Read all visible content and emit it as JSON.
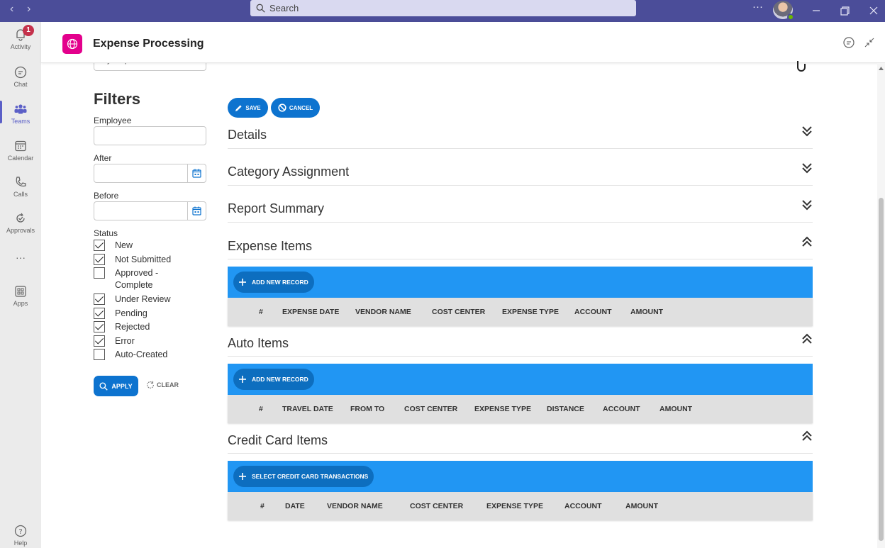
{
  "titlebar": {
    "search_placeholder": "Search",
    "more_label": "···"
  },
  "rail": {
    "items": [
      {
        "label": "Activity",
        "icon": "bell-icon",
        "badge": "1"
      },
      {
        "label": "Chat",
        "icon": "chat-icon"
      },
      {
        "label": "Teams",
        "icon": "teams-icon",
        "active": true
      },
      {
        "label": "Calendar",
        "icon": "calendar-icon"
      },
      {
        "label": "Calls",
        "icon": "phone-icon"
      },
      {
        "label": "Approvals",
        "icon": "approvals-icon"
      },
      {
        "label": "···",
        "icon": "more-icon"
      },
      {
        "label": "Apps",
        "icon": "apps-icon"
      },
      {
        "label": "Help",
        "icon": "help-icon"
      }
    ]
  },
  "app": {
    "title": "Expense Processing",
    "accent": "#e3008c"
  },
  "filters": {
    "view_select_value": "My Reports",
    "title": "Filters",
    "employee_label": "Employee",
    "employee_value": "",
    "after_label": "After",
    "after_value": "",
    "before_label": "Before",
    "before_value": "",
    "status_label": "Status",
    "statuses": [
      {
        "label": "New",
        "checked": true
      },
      {
        "label": "Not Submitted",
        "checked": true
      },
      {
        "label": "Approved -",
        "label2": "Complete",
        "checked": false
      },
      {
        "label": "Under Review",
        "checked": true
      },
      {
        "label": "Pending",
        "checked": true
      },
      {
        "label": "Rejected",
        "checked": true
      },
      {
        "label": "Error",
        "checked": true
      },
      {
        "label": "Auto-Created",
        "checked": false
      }
    ],
    "apply_label": "APPLY",
    "clear_label": "CLEAR"
  },
  "toolbar": {
    "save_label": "SAVE",
    "cancel_label": "CANCEL"
  },
  "sections": {
    "details": "Details",
    "category": "Category Assignment",
    "summary": "Report Summary",
    "expense_items": "Expense Items",
    "auto_items": "Auto Items",
    "credit_card_items": "Credit Card Items"
  },
  "expense_grid": {
    "add_label": "ADD NEW RECORD",
    "columns": [
      "#",
      "EXPENSE DATE",
      "VENDOR NAME",
      "COST CENTER",
      "EXPENSE TYPE",
      "ACCOUNT",
      "AMOUNT"
    ]
  },
  "auto_grid": {
    "add_label": "ADD NEW RECORD",
    "columns": [
      "#",
      "TRAVEL DATE",
      "FROM TO",
      "COST CENTER",
      "EXPENSE TYPE",
      "DISTANCE",
      "ACCOUNT",
      "AMOUNT"
    ]
  },
  "cc_grid": {
    "add_label": "SELECT CREDIT CARD TRANSACTIONS",
    "columns": [
      "#",
      "DATE",
      "VENDOR NAME",
      "COST CENTER",
      "EXPENSE TYPE",
      "ACCOUNT",
      "AMOUNT"
    ]
  },
  "colors": {
    "titlebar": "#4b4d99",
    "primary_button": "#0d73cf",
    "grid_toolbar": "#2196f3"
  }
}
